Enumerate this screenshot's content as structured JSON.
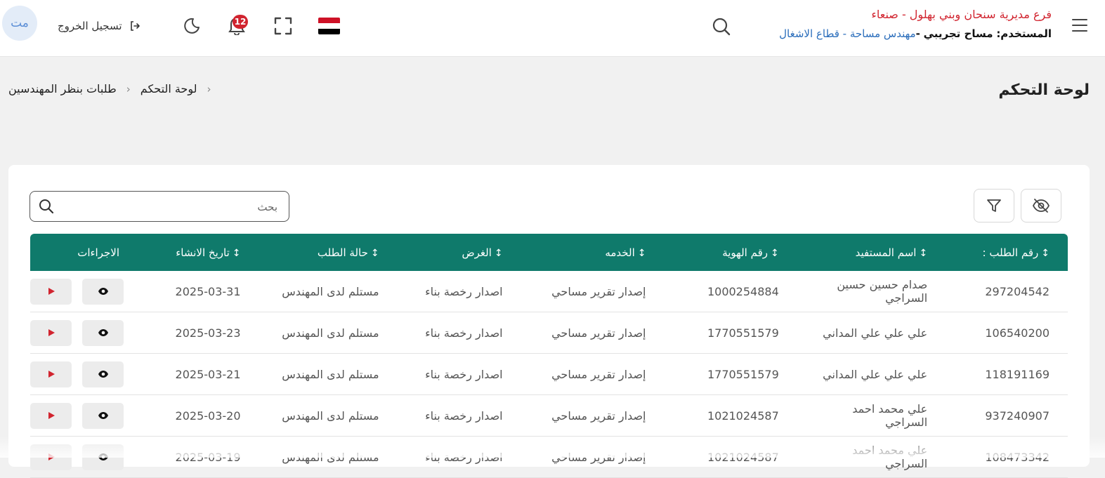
{
  "header": {
    "branch_name": "فرع مديرية سنحان وبني بهلول - صنعاء",
    "user_label": "المستخدم:",
    "user_name": "مساح تجريبي",
    "user_role": "مهندس مساحة - قطاع الاشغال",
    "notifications_count": "12",
    "logout_label": "تسجيل الخروج",
    "avatar_initials": "مت",
    "flag_colors": [
      "#ce1126",
      "#ffffff",
      "#000000"
    ]
  },
  "page": {
    "title": "لوحة التحكم",
    "breadcrumb": [
      "لوحة التحكم",
      "طلبات بنظر المهندسين"
    ]
  },
  "toolbar": {
    "search_placeholder": "بحث"
  },
  "table": {
    "accent_color": "#0f7a6b",
    "columns": [
      "رقم الطلب :",
      "اسم المستفيد",
      "رقم الهوية",
      "الخدمه",
      "الغرض",
      "حالة الطلب",
      "تاريخ الانشاء",
      "الاجراءات"
    ],
    "rows": [
      [
        "297204542",
        "صدام حسين حسين السراجي",
        "1000254884",
        "إصدار تقرير مساحي",
        "اصدار رخصة بناء",
        "مستلم لدى المهندس",
        "2025-03-31"
      ],
      [
        "106540200",
        "علي علي علي المداني",
        "1770551579",
        "إصدار تقرير مساحي",
        "اصدار رخصة بناء",
        "مستلم لدى المهندس",
        "2025-03-23"
      ],
      [
        "118191169",
        "علي علي علي المداني",
        "1770551579",
        "إصدار تقرير مساحي",
        "اصدار رخصة بناء",
        "مستلم لدى المهندس",
        "2025-03-21"
      ],
      [
        "937240907",
        "علي محمد احمد السراجي",
        "1021024587",
        "إصدار تقرير مساحي",
        "اصدار رخصة بناء",
        "مستلم لدى المهندس",
        "2025-03-20"
      ],
      [
        "108473342",
        "علي محمد احمد السراجي",
        "1021024587",
        "إصدار تقرير مساحي",
        "اصدار رخصة بناء",
        "مستلم لدى المهندس",
        "2025-03-19"
      ]
    ]
  }
}
